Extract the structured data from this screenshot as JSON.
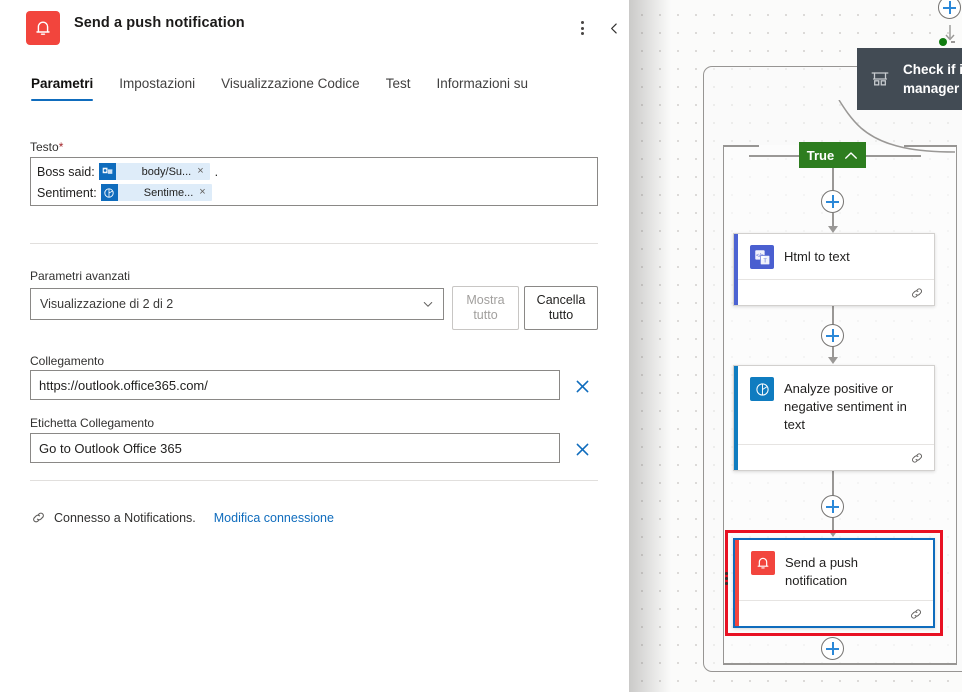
{
  "panel": {
    "icon": "bell-icon",
    "title": "Send a push notification",
    "more_label": "more-options",
    "collapse_label": "collapse-panel",
    "tabs": [
      {
        "label": "Parametri",
        "active": true
      },
      {
        "label": "Impostazioni",
        "active": false
      },
      {
        "label": "Visualizzazione Codice",
        "active": false
      },
      {
        "label": "Test",
        "active": false
      },
      {
        "label": "Informazioni su",
        "active": false
      }
    ]
  },
  "form": {
    "testo": {
      "label": "Testo",
      "required_marker": "*",
      "lines": [
        {
          "prefix": "Boss said:",
          "token": {
            "text": "body/Su...",
            "icon": "outlook-icon",
            "remove": "×"
          },
          "suffix": "."
        },
        {
          "prefix": "Sentiment:",
          "token": {
            "text": "Sentime...",
            "icon": "sentiment-icon",
            "remove": "×"
          },
          "suffix": ""
        }
      ]
    },
    "advanced": {
      "label": "Parametri avanzati",
      "select_value": "Visualizzazione di 2 di 2",
      "show_all_button": "Mostra tutto",
      "show_all_disabled": true,
      "clear_all_button": "Cancella tutto"
    },
    "link": {
      "label": "Collegamento",
      "value": "https://outlook.office365.com/",
      "placeholder": "",
      "clear_icon": "close-icon"
    },
    "link_label_field": {
      "label": "Etichetta Collegamento",
      "value": "Go to Outlook Office 365",
      "placeholder": "",
      "clear_icon": "close-icon"
    },
    "connection": {
      "icon": "link-icon",
      "text": "Connesso a Notifications.",
      "action": "Modifica connessione"
    }
  },
  "canvas": {
    "tooltip": {
      "icon": "approval-icon",
      "text": "Check if i\nmanager"
    },
    "branch_label": {
      "text": "True",
      "chevron": "chevron-up-icon"
    },
    "nodes": [
      {
        "id": "html-to-text",
        "title": "Html to text",
        "icon": "html-to-text-icon",
        "accent": "#4c63d2",
        "footer_icon": "link-icon",
        "selected": false
      },
      {
        "id": "analyze-sentiment",
        "title": "Analyze positive or negative sentiment in text",
        "icon": "sentiment-icon",
        "accent": "#0f7cc0",
        "footer_icon": "link-icon",
        "selected": false
      },
      {
        "id": "send-push-notification",
        "title": "Send a push notification",
        "icon": "bell-icon",
        "accent": "#f2453d",
        "footer_icon": "link-icon",
        "selected": true,
        "menu_icon": "kebab-menu-icon"
      }
    ],
    "add_buttons": [
      "add-step-top",
      "add-step-after-html-to-text",
      "add-step-after-analyze-sentiment",
      "add-step-after-send-push-notification",
      "add-step-canvas-top"
    ],
    "status_dot_color": "#107c10",
    "selection_highlight_color": "#e81123",
    "selection_border_color": "#0f6cbd"
  }
}
